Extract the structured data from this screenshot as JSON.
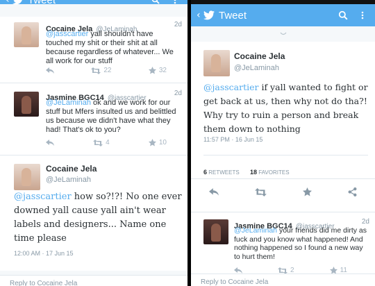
{
  "app": {
    "title": "Tweet",
    "accent": "#55acee"
  },
  "left": {
    "tweets": [
      {
        "name": "Cocaine Jela",
        "handle": "@JeLaminah",
        "time": "2d",
        "text_mention": "@jasscartier",
        "text": " yall shouldn't have touched my shit or their shit at all because regardless of whatever... We all work for our stuff",
        "retweets": "22",
        "favorites": "32"
      },
      {
        "name": "Jasmine BGC14",
        "handle": "@jasscartier",
        "time": "2d",
        "text_mention": "@JeLaminah",
        "text": " ok and we work for our stuff but Mfers insulted us and belittled us because we didn't have what they had! That's ok to you?",
        "retweets": "4",
        "favorites": "10"
      }
    ],
    "main": {
      "name": "Cocaine Jela",
      "handle": "@JeLaminah",
      "mention": "@jasscartier",
      "text": " how so?!?! No one ever downed yall cause yall ain't wear labels and designers... Name one time please",
      "meta": "12:00 AM · 17 Jun 15"
    },
    "reply_placeholder": "Reply to Cocaine Jela"
  },
  "right": {
    "main": {
      "name": "Cocaine Jela",
      "handle": "@JeLaminah",
      "mention": "@jasscartier",
      "text": " if yall wanted to fight or get back at us, then why not do tha?! Why try to ruin a person and break them down to nothing",
      "meta": "11:57 PM · 16 Jun 15",
      "retweets_count": "6",
      "retweets_label": "RETWEETS",
      "favorites_count": "18",
      "favorites_label": "FAVORITES"
    },
    "reply_tweet": {
      "name": "Jasmine BGC14",
      "handle": "@jasscartier",
      "time": "2d",
      "mention": "@JeLaminah",
      "text": " your friends did me dirty as fuck and you know what happened! And nothing happened so I found a new way to hurt them!",
      "retweets": "2",
      "favorites": "11"
    },
    "reply_placeholder": "Reply to Cocaine Jela"
  }
}
